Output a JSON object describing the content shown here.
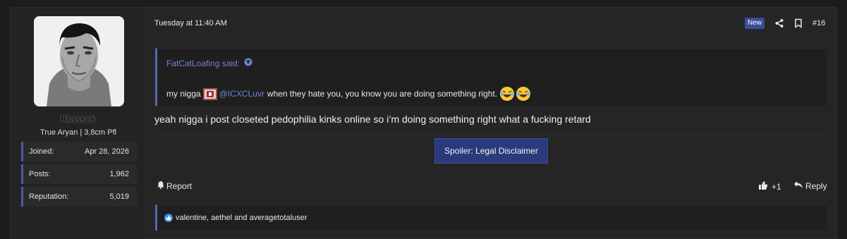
{
  "post": {
    "timestamp": "Tuesday at 11:40 AM",
    "new_badge": "New",
    "post_number": "#16",
    "body": "yeah nigga i post closeted pedophilia kinks online so i’m doing something right what a fucking retard",
    "spoiler_label": "Spoiler: Legal Disclaimer",
    "report_label": "Report",
    "like_count": "+1",
    "reply_label": "Reply",
    "reactions_text": "valentine, aethel and averagetotaluser"
  },
  "user": {
    "name": "Klassek",
    "title": "True Aryan | 3,8cm Pfl",
    "stats": [
      {
        "label": "Joined:",
        "value": "Apr 28, 2026"
      },
      {
        "label": "Posts:",
        "value": "1,962"
      },
      {
        "label": "Reputation:",
        "value": "5,019"
      }
    ]
  },
  "quote": {
    "author": "FatCatLoafing said:",
    "text_before": "my nigga",
    "mention": "@ICXCLuvr",
    "text_after": "when they hate you, you know you are doing something right."
  },
  "colors": {
    "accent": "#5b66b4",
    "link": "#6f82d9",
    "badge": "#3b4b98",
    "spoiler": "#2a3a7c"
  },
  "icons": [
    "share-icon",
    "bookmark-icon",
    "arrow-up-circle-icon",
    "bell-icon",
    "thumbs-up-icon",
    "reply-icon",
    "laughing-emoji-icon",
    "like-reaction-icon"
  ]
}
